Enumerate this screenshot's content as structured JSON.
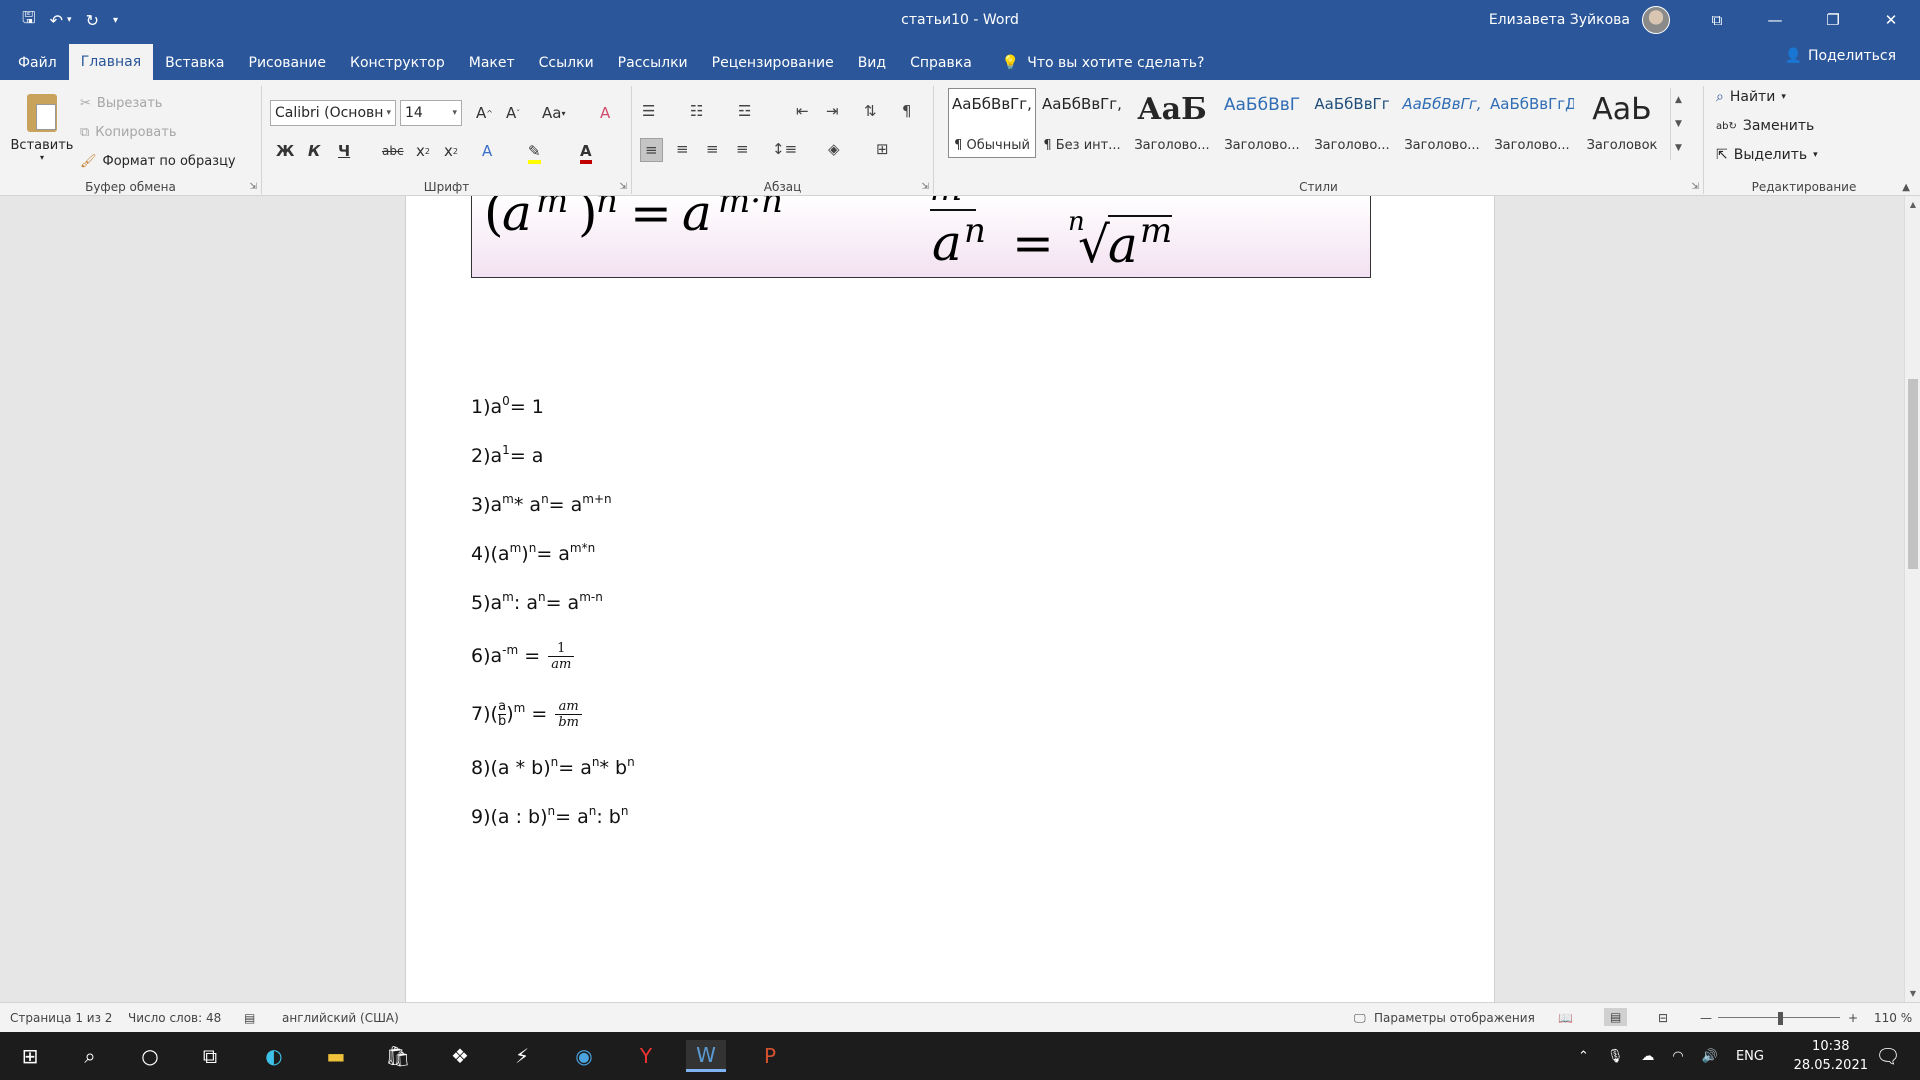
{
  "window": {
    "title": "статьи10  -  Word",
    "user_name": "Елизавета Зуйкова"
  },
  "tabs": [
    "Файл",
    "Главная",
    "Вставка",
    "Рисование",
    "Конструктор",
    "Макет",
    "Ссылки",
    "Рассылки",
    "Рецензирование",
    "Вид",
    "Справка"
  ],
  "tell_me": "Что вы хотите сделать?",
  "share": "Поделиться",
  "clipboard": {
    "paste": "Вставить",
    "cut": "Вырезать",
    "copy": "Копировать",
    "format_painter": "Формат по образцу",
    "label": "Буфер обмена"
  },
  "font": {
    "name": "Calibri (Основн",
    "size": "14",
    "label": "Шрифт",
    "bold": "Ж",
    "italic": "К",
    "underline": "Ч",
    "strike": "abc"
  },
  "paragraph": {
    "label": "Абзац"
  },
  "styles": {
    "label": "Стили",
    "items": [
      {
        "sample": "АаБбВвГг,",
        "name": "¶ Обычный"
      },
      {
        "sample": "АаБбВвГг,",
        "name": "¶ Без инт..."
      },
      {
        "sample": "АаБ",
        "name": "Заголово..."
      },
      {
        "sample": "АаБбВвГ",
        "name": "Заголово..."
      },
      {
        "sample": "АаБбВвГг",
        "name": "Заголово..."
      },
      {
        "sample": "АаБбВвГг,",
        "name": "Заголово..."
      },
      {
        "sample": "АаБбВвГгД",
        "name": "Заголово..."
      },
      {
        "sample": "АаЬ",
        "name": "Заголовок"
      }
    ]
  },
  "editing": {
    "label": "Редактирование",
    "find": "Найти",
    "replace": "Заменить",
    "select": "Выделить"
  },
  "document": {
    "list": [
      {
        "num": "1) ",
        "pre": "a",
        "sup": "0",
        "post": " = 1"
      },
      {
        "num": "2) ",
        "pre": "a",
        "sup": "1",
        "post": " = a"
      },
      {
        "num": "3) ",
        "pre": "a",
        "sup": "m",
        "mid": " * a",
        "sup2": "n",
        "post": " = a",
        "sup3": "m+n"
      },
      {
        "num": "4) ",
        "pre": "(a",
        "sup": "m",
        "mid": ")",
        "sup2": "n",
        "post": " = a",
        "sup3": "m*n"
      },
      {
        "num": "5) ",
        "pre": "a",
        "sup": "m",
        "mid": " : a",
        "sup2": "n",
        "post": " = a",
        "sup3": "m-n"
      },
      {
        "num": "6) ",
        "pre": "a",
        "sup": "-m",
        "post": " = ",
        "frac_num": "1",
        "frac_den": "am"
      },
      {
        "num": "7) ",
        "pre": "(",
        "small_num": "a",
        "small_den": "b",
        "mid": ")",
        "sup2": "m",
        "post": " = ",
        "frac_num": "am",
        "frac_den": "bm"
      },
      {
        "num": "8) ",
        "pre": "(a * b)",
        "sup": "n",
        "post": "= a",
        "sup2": "n",
        "mid": " * b",
        "sup3": "n"
      },
      {
        "num": "9) ",
        "pre": "(a : b)",
        "sup": "n",
        "post": "= a",
        "sup2": "n",
        "mid": " : b",
        "sup3": "n"
      }
    ]
  },
  "status": {
    "page": "Страница 1 из 2",
    "words": "Число слов: 48",
    "language": "английский (США)",
    "display_settings": "Параметры отображения",
    "zoom": "110 %"
  },
  "taskbar": {
    "lang": "ENG",
    "time": "10:38",
    "date": "28.05.2021"
  }
}
